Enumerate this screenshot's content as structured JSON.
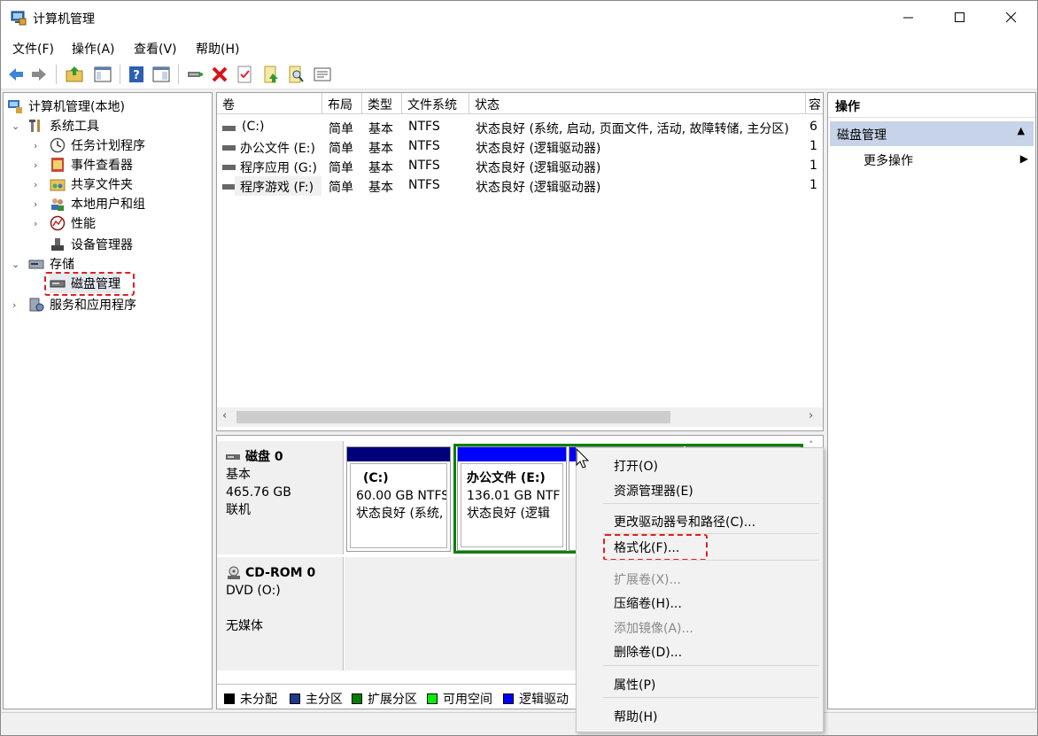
{
  "window": {
    "title": "计算机管理"
  },
  "menu": [
    "文件(F)",
    "操作(A)",
    "查看(V)",
    "帮助(H)"
  ],
  "toolbar_icons": [
    "back-icon",
    "forward-icon",
    "up-folder-icon",
    "show-hide-tree-icon",
    "help-icon",
    "properties-icon",
    "connect-icon",
    "delete-icon",
    "check-icon",
    "export-icon",
    "search-icon",
    "list-icon"
  ],
  "tree": {
    "root": "计算机管理(本地)",
    "system_tools": "系统工具",
    "task_scheduler": "任务计划程序",
    "event_viewer": "事件查看器",
    "shared_folders": "共享文件夹",
    "local_users": "本地用户和组",
    "performance": "性能",
    "device_manager": "设备管理器",
    "storage": "存储",
    "disk_management": "磁盘管理",
    "services": "服务和应用程序"
  },
  "volumes": {
    "headers": [
      "卷",
      "布局",
      "类型",
      "文件系统",
      "状态",
      "容"
    ],
    "rows": [
      {
        "vol": "(C:)",
        "layout": "简单",
        "type": "基本",
        "fs": "NTFS",
        "status": "状态良好 (系统, 启动, 页面文件, 活动, 故障转储, 主分区)",
        "cap": "6"
      },
      {
        "vol": "办公文件 (E:)",
        "layout": "简单",
        "type": "基本",
        "fs": "NTFS",
        "status": "状态良好 (逻辑驱动器)",
        "cap": "1"
      },
      {
        "vol": "程序应用 (G:)",
        "layout": "简单",
        "type": "基本",
        "fs": "NTFS",
        "status": "状态良好 (逻辑驱动器)",
        "cap": "1"
      },
      {
        "vol": "程序游戏 (F:)",
        "layout": "简单",
        "type": "基本",
        "fs": "NTFS",
        "status": "状态良好 (逻辑驱动器)",
        "cap": "1"
      }
    ]
  },
  "disk0": {
    "name": "磁盘 0",
    "type": "基本",
    "size": "465.76 GB",
    "state": "联机"
  },
  "partitions": [
    {
      "title": "(C:)",
      "size": "60.00 GB NTFS",
      "status": "状态良好 (系统,"
    },
    {
      "title": "办公文件  (E:)",
      "size": "136.01 GB NTF",
      "status": "状态良好 (逻辑"
    }
  ],
  "cdrom": {
    "name": "CD-ROM 0",
    "drive": "DVD (O:)",
    "media": "无媒体"
  },
  "legend": [
    {
      "label": "未分配",
      "color": "#000000"
    },
    {
      "label": "主分区",
      "color": "#1e3a8a"
    },
    {
      "label": "扩展分区",
      "color": "#008000"
    },
    {
      "label": "可用空间",
      "color": "#00ee00"
    },
    {
      "label": "逻辑驱动",
      "color": "#0000ff"
    }
  ],
  "context_menu": {
    "open": "打开(O)",
    "explorer": "资源管理器(E)",
    "change_letter": "更改驱动器号和路径(C)...",
    "format": "格式化(F)...",
    "extend": "扩展卷(X)...",
    "shrink": "压缩卷(H)...",
    "add_mirror": "添加镜像(A)...",
    "delete": "删除卷(D)...",
    "properties": "属性(P)",
    "help": "帮助(H)"
  },
  "actions": {
    "header": "操作",
    "section": "磁盘管理",
    "more": "更多操作"
  },
  "colors": {
    "primary_bar": "#0000d8",
    "highlight_dash": "#e02020",
    "extended_border": "#008000",
    "actions_section": "#c6d3e8"
  }
}
